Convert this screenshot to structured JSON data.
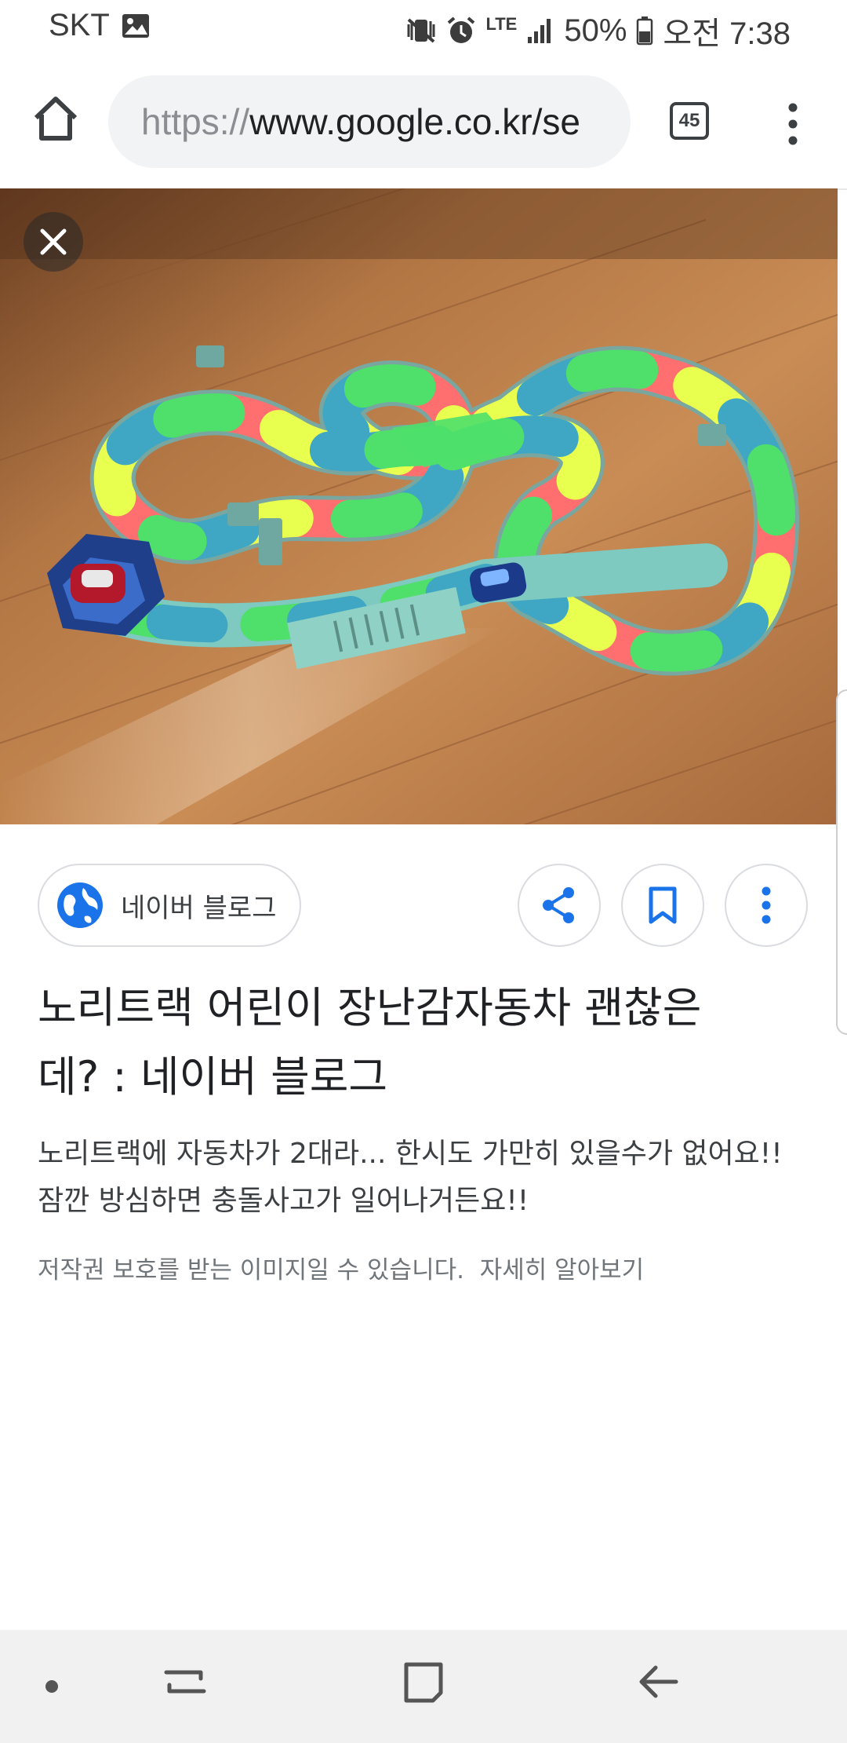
{
  "status_bar": {
    "carrier": "SKT",
    "network": "LTE",
    "battery": "50%",
    "time": "오전 7:38"
  },
  "browser": {
    "url_scheme": "https://",
    "url_rest": "www.google.co.kr/se",
    "tab_count": "45"
  },
  "result": {
    "source_label": "네이버 블로그",
    "title": "노리트랙 어린이 장난감자동차 괜찮은데? : 네이버 블로그",
    "description": "노리트랙에 자동차가 2대라... 한시도 가만히 있을수가 없어요!! 잠깐 방심하면 충돌사고가 일어나거든요!!",
    "copyright_notice": "저작권 보호를 받는 이미지일 수 있습니다.",
    "learn_more": "자세히 알아보기"
  },
  "colors": {
    "accent": "#1a73e8",
    "chip_border": "#dadce0",
    "nav_bg": "#f1f1f1"
  },
  "icons": {
    "home": "home-icon",
    "close": "close-icon",
    "share": "share-icon",
    "bookmark": "bookmark-icon",
    "more": "more-vert-icon",
    "globe": "globe-icon"
  }
}
